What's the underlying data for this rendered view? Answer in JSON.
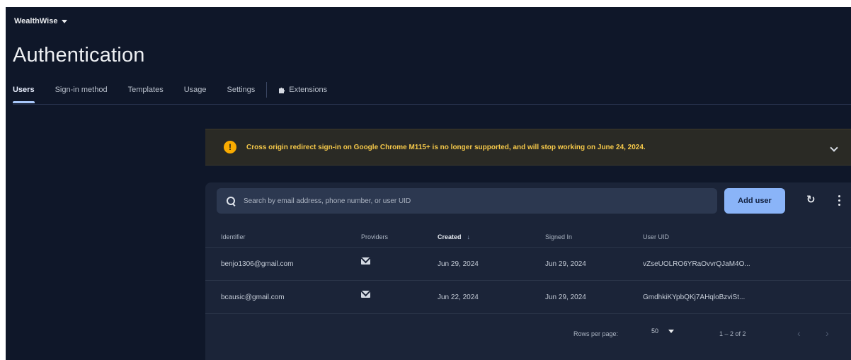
{
  "project": {
    "name": "WealthWise"
  },
  "page": {
    "title": "Authentication"
  },
  "tabs": [
    {
      "label": "Users",
      "active": true
    },
    {
      "label": "Sign-in method",
      "active": false
    },
    {
      "label": "Templates",
      "active": false
    },
    {
      "label": "Usage",
      "active": false
    },
    {
      "label": "Settings",
      "active": false
    },
    {
      "label": "Extensions",
      "active": false,
      "icon": "puzzle-icon"
    }
  ],
  "banner": {
    "icon": "warning-icon",
    "text": "Cross origin redirect sign-in on Google Chrome M115+ is no longer supported, and will stop working on June 24, 2024."
  },
  "toolbar": {
    "search_placeholder": "Search by email address, phone number, or user UID",
    "add_user_label": "Add user"
  },
  "table": {
    "columns": [
      "Identifier",
      "Providers",
      "Created",
      "Signed In",
      "User UID"
    ],
    "sorted_column": "Created",
    "rows": [
      {
        "identifier": "benjo1306@gmail.com",
        "provider": "mail-icon",
        "created": "Jun 29, 2024",
        "signed_in": "Jun 29, 2024",
        "uid": "vZseUOLRO6YRaOvvrQJaM4O..."
      },
      {
        "identifier": "bcausic@gmail.com",
        "provider": "mail-icon",
        "created": "Jun 22, 2024",
        "signed_in": "Jun 29, 2024",
        "uid": "GmdhkiKYpbQKj7AHqloBzviSt..."
      }
    ]
  },
  "pagination": {
    "rows_per_page_label": "Rows per page:",
    "rows_per_page_value": "50",
    "range": "1 – 2 of 2"
  },
  "colors": {
    "background": "#0f1729",
    "panel": "#1b2438",
    "accent": "#8ab4f8",
    "warning": "#f9ab00"
  }
}
